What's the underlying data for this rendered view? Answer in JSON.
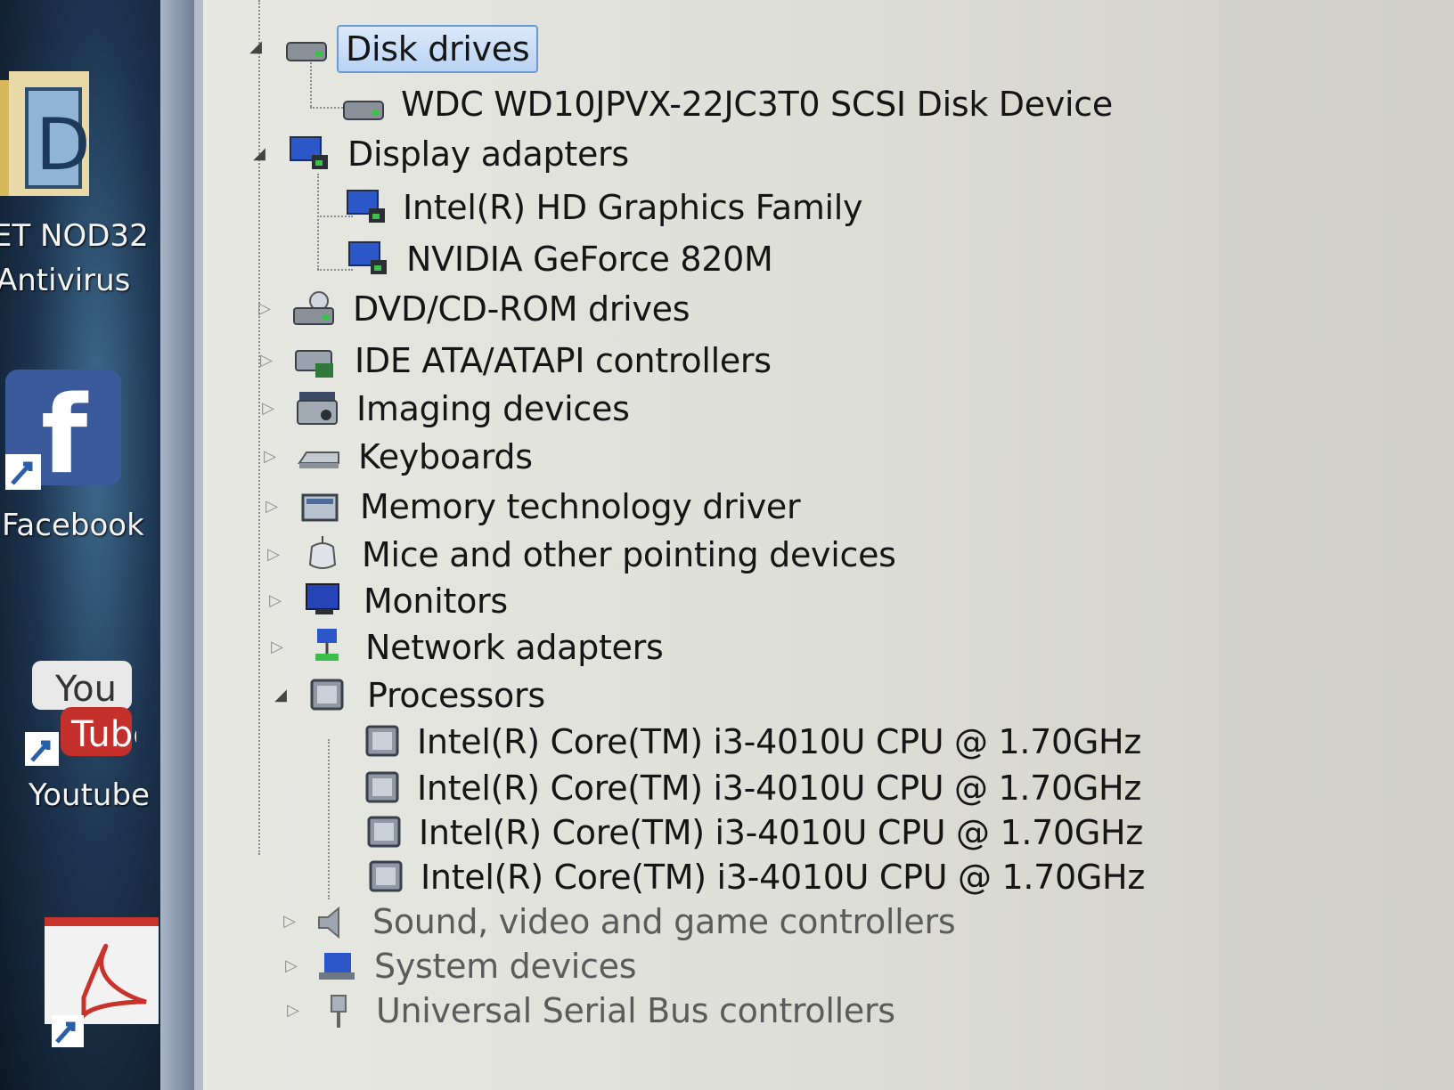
{
  "desktop": {
    "icons": [
      {
        "label_line1": "ET NOD32",
        "label_line2": "Antivirus"
      },
      {
        "label": "Facebook"
      },
      {
        "label": "Youtube"
      }
    ]
  },
  "tree": {
    "disk_drives": {
      "label": "Disk drives",
      "children": [
        "WDC WD10JPVX-22JC3T0 SCSI Disk Device"
      ]
    },
    "display_adapters": {
      "label": "Display adapters",
      "children": [
        "Intel(R) HD Graphics Family",
        "NVIDIA GeForce 820M"
      ]
    },
    "collapsed_categories": [
      "DVD/CD-ROM drives",
      "IDE ATA/ATAPI controllers",
      "Imaging devices",
      "Keyboards",
      "Memory technology driver",
      "Mice and other pointing devices",
      "Monitors",
      "Network adapters"
    ],
    "processors": {
      "label": "Processors",
      "children": [
        "Intel(R) Core(TM) i3-4010U CPU @ 1.70GHz",
        "Intel(R) Core(TM) i3-4010U CPU @ 1.70GHz",
        "Intel(R) Core(TM) i3-4010U CPU @ 1.70GHz",
        "Intel(R) Core(TM) i3-4010U CPU @ 1.70GHz"
      ]
    },
    "trailing_categories": [
      "Sound, video and game controllers",
      "System devices",
      "Universal Serial Bus controllers"
    ]
  },
  "colors": {
    "selection_fill": "#b9d3f2",
    "selection_border": "#6a9ad8",
    "tree_background": "#e2e2dd"
  }
}
